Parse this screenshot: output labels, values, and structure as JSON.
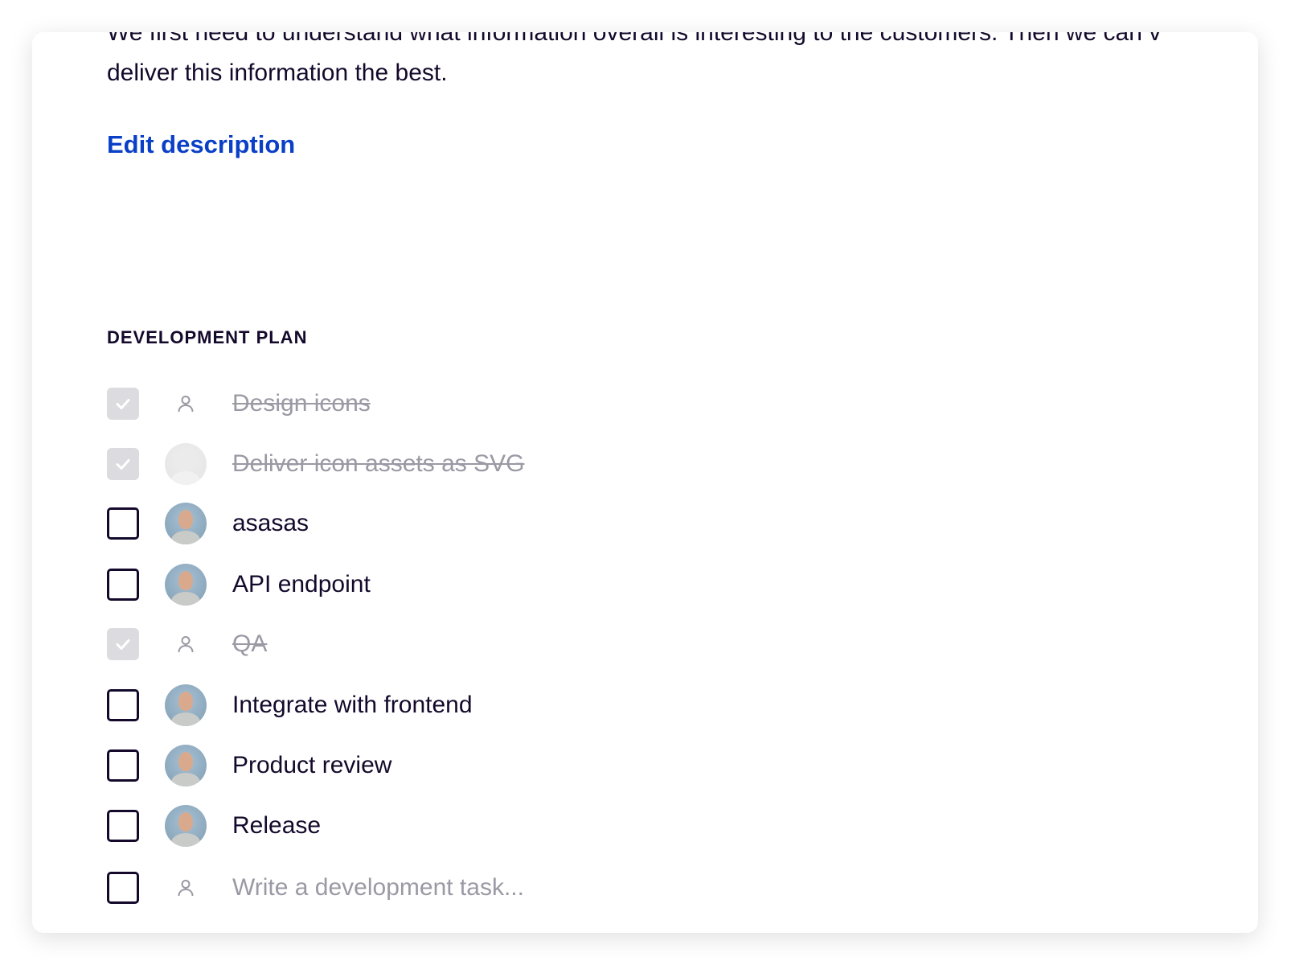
{
  "description": {
    "line1": "We first need to understand what information overall is interesting to the customers. Then we can v",
    "line2": "deliver this information the best.",
    "edit_link": "Edit description"
  },
  "development_plan": {
    "heading": "DEVELOPMENT PLAN",
    "tasks": [
      {
        "label": "Design icons",
        "done": true,
        "assignee": "person-icon"
      },
      {
        "label": "Deliver icon assets as SVG",
        "done": true,
        "assignee": "avatar"
      },
      {
        "label": "asasas",
        "done": false,
        "assignee": "avatar"
      },
      {
        "label": "API endpoint",
        "done": false,
        "assignee": "avatar"
      },
      {
        "label": "QA",
        "done": true,
        "assignee": "person-icon"
      },
      {
        "label": "Integrate with frontend",
        "done": false,
        "assignee": "avatar"
      },
      {
        "label": "Product review",
        "done": false,
        "assignee": "avatar"
      },
      {
        "label": "Release",
        "done": false,
        "assignee": "avatar"
      }
    ],
    "new_task_placeholder": "Write a development task..."
  },
  "colors": {
    "link": "#0a3fc7",
    "text": "#14092b",
    "muted": "#9a99a4",
    "checked_bg": "#dcdce0"
  }
}
